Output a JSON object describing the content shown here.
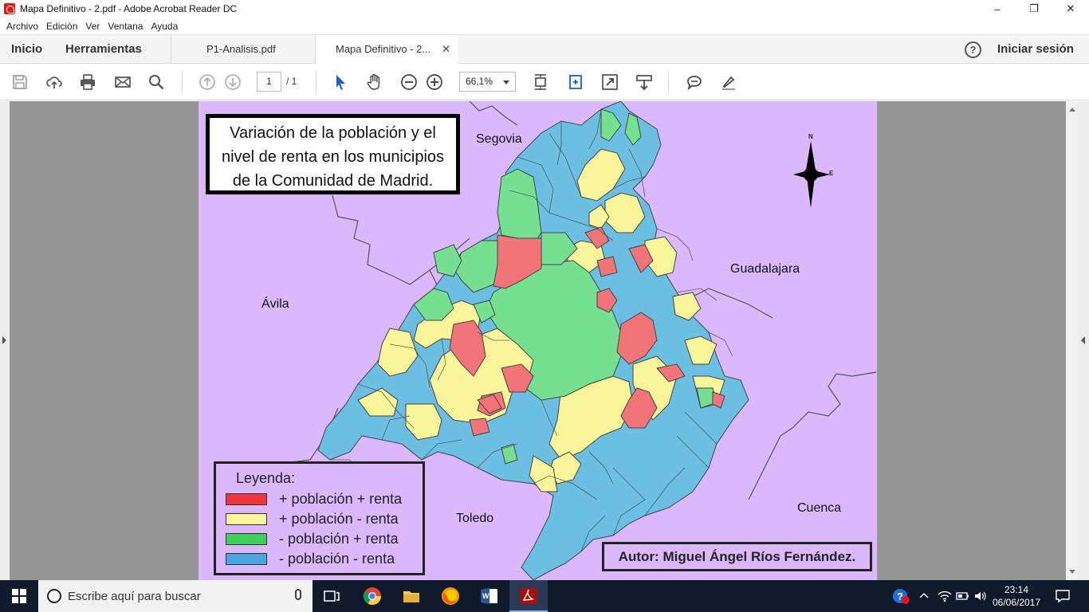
{
  "window": {
    "title": "Mapa Definitivo - 2.pdf - Adobe Acrobat Reader DC",
    "minimize": "–",
    "restore": "❐",
    "close": "✕"
  },
  "menu": [
    "Archivo",
    "Edición",
    "Ver",
    "Ventana",
    "Ayuda"
  ],
  "tabs": {
    "home": "Inicio",
    "tools": "Herramientas",
    "doc1": "P1-Analisis.pdf",
    "doc2": "Mapa Definitivo - 2...",
    "doc2_close": "✕",
    "help": "?",
    "signin": "Iniciar sesión"
  },
  "toolbar": {
    "page_current": "1",
    "page_total": "/ 1",
    "zoom": "66,1%"
  },
  "map": {
    "title": "Variación de la población y el nivel de renta en los municipios de la Comunidad de Madrid.",
    "title_lines": [
      "Variación de la población y el",
      "nivel de renta en los municipios",
      "de la Comunidad de Madrid."
    ],
    "regions": {
      "segovia": "Segovia",
      "guadalajara": "Guadalajara",
      "avila": "Ávila",
      "toledo": "Toledo",
      "cuenca": "Cuenca"
    },
    "compass": {
      "north": "N",
      "east": "E"
    },
    "legend": {
      "title": "Leyenda:",
      "items": [
        {
          "label": "+ población + renta",
          "color": "#f07478"
        },
        {
          "label": "+ población - renta",
          "color": "#f8f59a"
        },
        {
          "label": "- población + renta",
          "color": "#75e08f"
        },
        {
          "label": "- población - renta",
          "color": "#6bbfe2"
        }
      ],
      "swatch_colors": [
        "#f0353f",
        "#f8f59a",
        "#3ed05c",
        "#4aa6e0"
      ]
    },
    "author": "Autor: Miguel Ángel Ríos Fernández."
  },
  "taskbar": {
    "search_placeholder": "Escribe aquí para buscar",
    "time": "23:14",
    "date": "06/06/2017"
  }
}
